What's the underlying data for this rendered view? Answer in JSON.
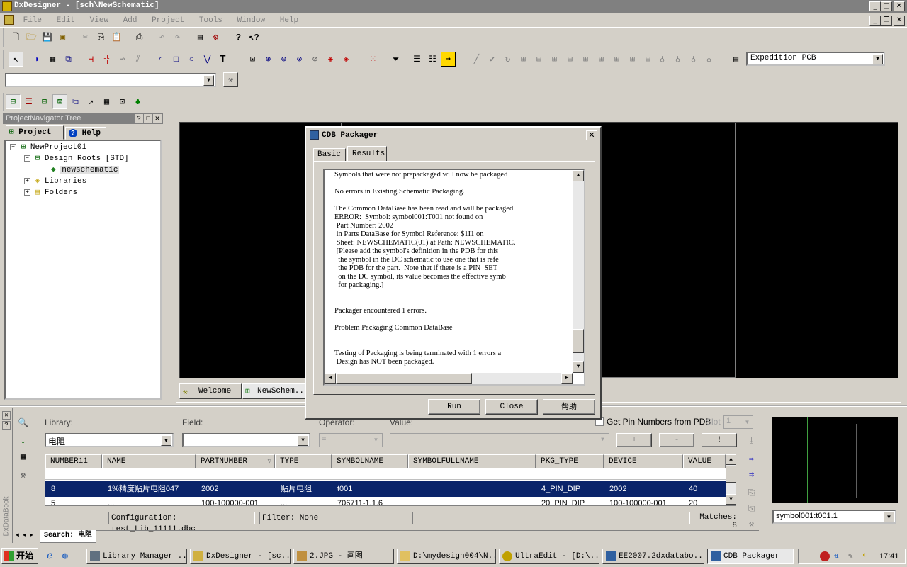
{
  "window": {
    "title": "DxDesigner - [sch\\NewSchematic]"
  },
  "menu": [
    "File",
    "Edit",
    "View",
    "Add",
    "Project",
    "Tools",
    "Window",
    "Help"
  ],
  "toolbar": {
    "flow_value": "Expedition PCB",
    "combo_value": ""
  },
  "navigator": {
    "title": "ProjectNavigator Tree",
    "tabs": [
      "Project",
      "Help"
    ],
    "tree": [
      "NewProject01",
      "Design Roots [STD]",
      "newschematic",
      "Libraries",
      "Folders"
    ]
  },
  "doc_tabs": [
    "Welcome",
    "NewSchem..."
  ],
  "dialog": {
    "title": "CDB Packager",
    "tabs": [
      "Basic",
      "Results"
    ],
    "log": [
      "Symbols that were not prepackaged will now be packaged",
      "",
      "No errors in Existing Schematic Packaging.",
      "",
      "The Common DataBase has been read and will be packaged.",
      "ERROR:  Symbol: symbol001:T001 not found on",
      " Part Number: 2002",
      " in Parts DataBase for Symbol Reference: $1I1 on",
      " Sheet: NEWSCHEMATIC(01) at Path: NEWSCHEMATIC.",
      " [Please add the symbol's definition in the PDB for this",
      "  the symbol in the DC schematic to use one that is refe",
      "  the PDB for the part.  Note that if there is a PIN_SET",
      "  on the DC symbol, its value becomes the effective symb",
      "  for packaging.]",
      "",
      "",
      "Packager encountered 1 errors.",
      "",
      "Problem Packaging Common DataBase",
      "",
      "",
      "Testing of Packaging is being terminated with 1 errors a",
      " Design has NOT been packaged."
    ],
    "buttons": {
      "run": "Run",
      "close": "Close",
      "help": "帮助"
    }
  },
  "databook": {
    "side_label": "DxDataBook",
    "library_label": "Library:",
    "library_value": "电阻",
    "field_label": "Field:",
    "field_value": "",
    "operator_label": "Operator:",
    "operator_value": "=",
    "value_label": "Value:",
    "value_value": "",
    "get_pin_label": "Get Pin Numbers from PDB",
    "slot_label": "Slot",
    "slot_value": "1",
    "plus": "+",
    "minus": "-",
    "excl": "!",
    "columns": [
      "NUMBER11",
      "NAME",
      "PARTNUMBER",
      "TYPE",
      "SYMBOLNAME",
      "SYMBOLFULLNAME",
      "PKG_TYPE",
      "DEVICE",
      "VALUE"
    ],
    "row_selected": [
      "8",
      "1%精度贴片电阻047",
      "2002",
      "贴片电阻",
      "t001",
      "",
      "4_PIN_DIP",
      "2002",
      "40"
    ],
    "row_partial": [
      "5",
      "...",
      "100-100000-001",
      "...",
      "706711-1.1.6",
      "",
      "20_PIN_DIP",
      "100-100000-001",
      "20"
    ],
    "status": {
      "configuration": "Configuration: test_Lib_11111.dbc",
      "filter": "Filter: None",
      "matches": "Matches: 8"
    },
    "search_tab": "Search: 电阻",
    "preview_symbol": "symbol001:t001.1"
  },
  "taskbar": {
    "start": "开始",
    "items": [
      "Library Manager ...",
      "DxDesigner - [sc...",
      "2.JPG - 画图",
      "D:\\mydesign004\\N...",
      "UltraEdit - [D:\\...",
      "EE2007.2dxdatabo...",
      "CDB Packager"
    ],
    "clock": "17:41"
  }
}
